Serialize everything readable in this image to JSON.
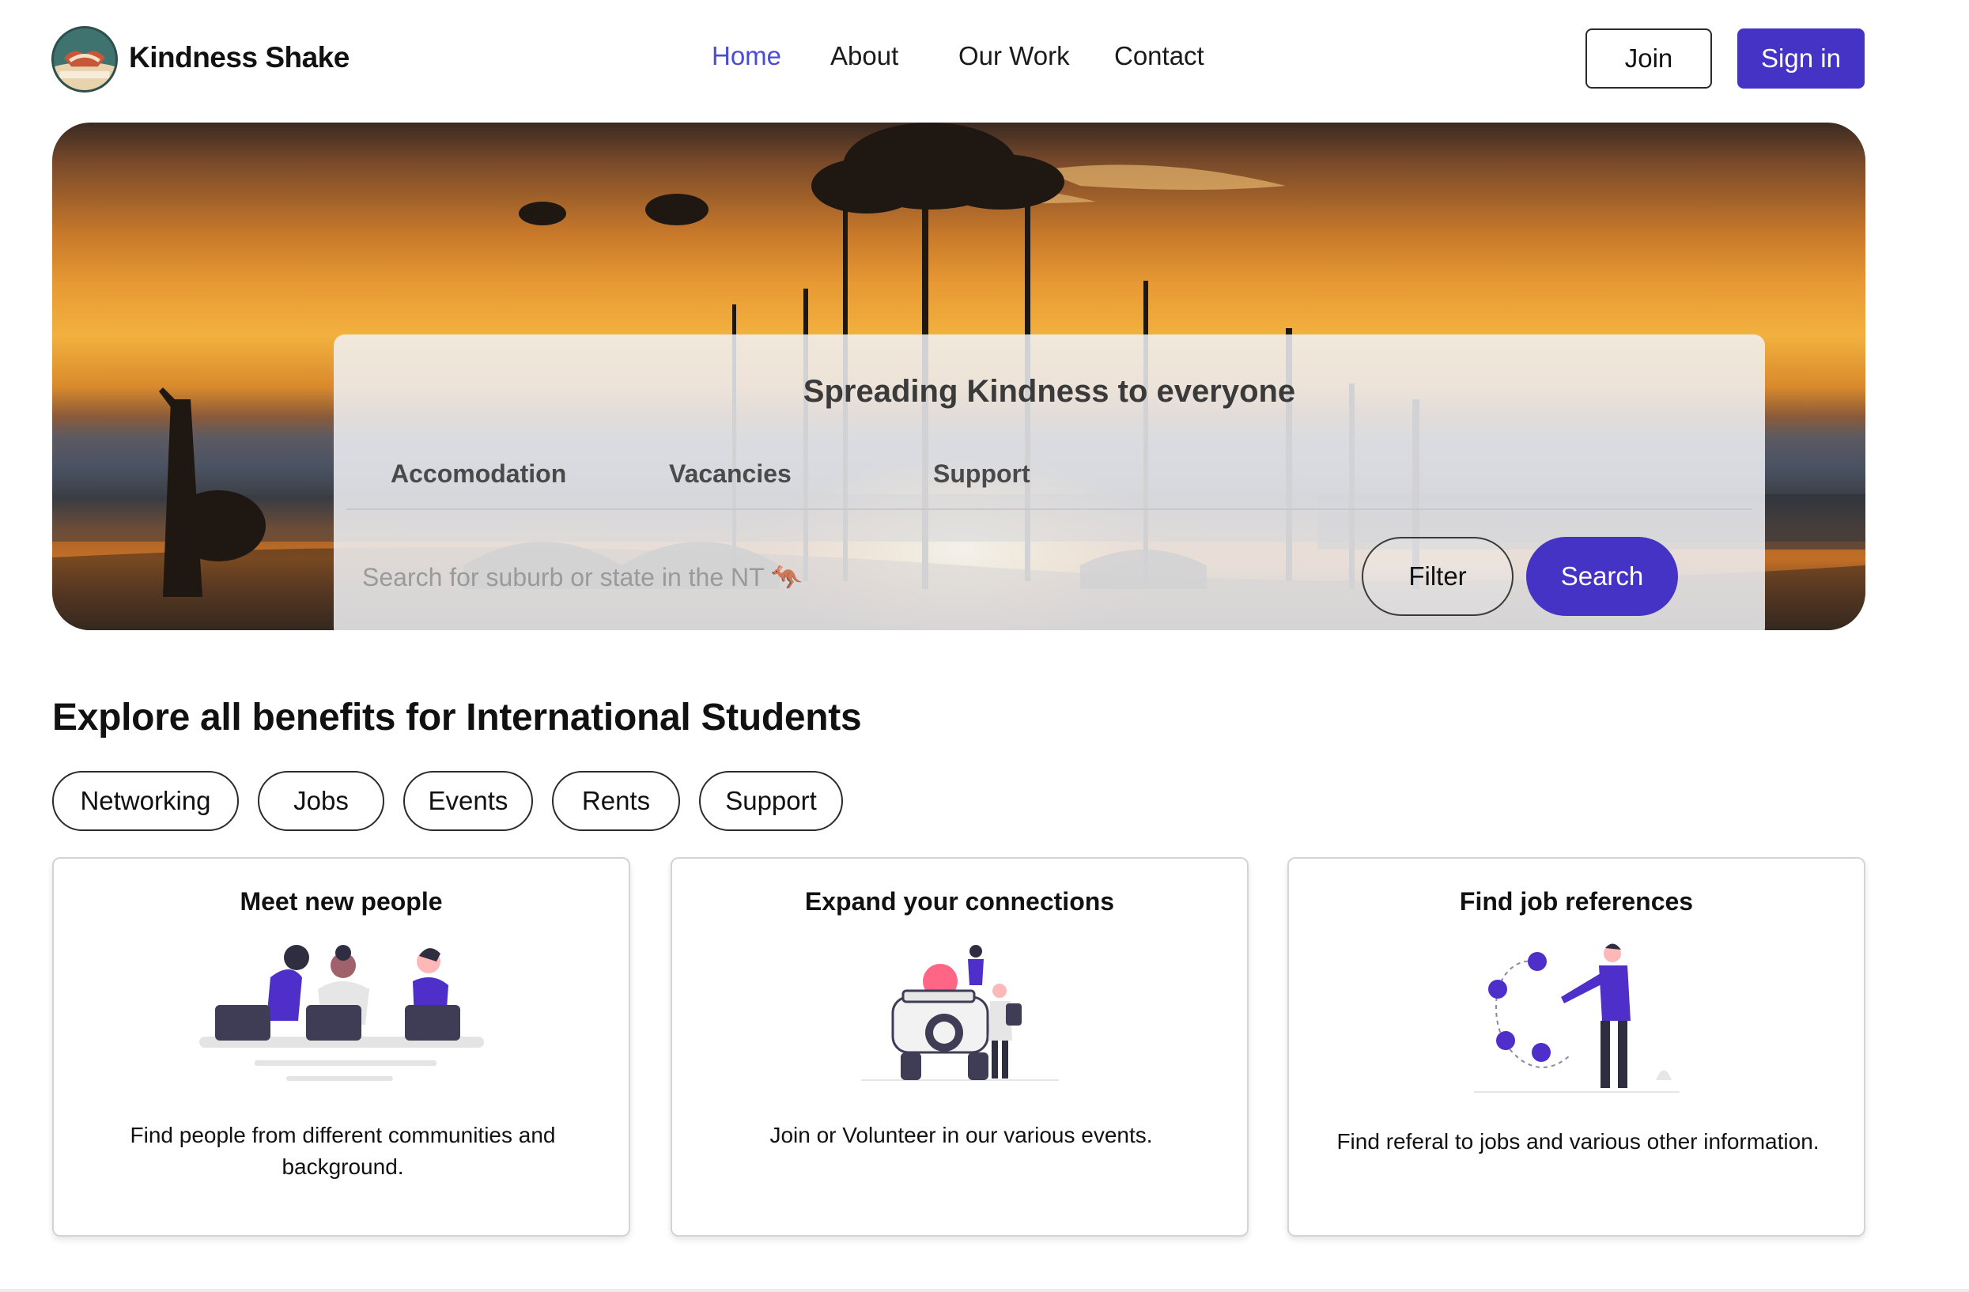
{
  "header": {
    "brand": "Kindness Shake",
    "logo_text": "#KINDNESSSHAKE",
    "nav": [
      {
        "label": "Home",
        "active": true
      },
      {
        "label": "About",
        "active": false
      },
      {
        "label": "Our Work",
        "active": false
      },
      {
        "label": "Contact",
        "active": false
      }
    ],
    "join_label": "Join",
    "signin_label": "Sign in"
  },
  "hero": {
    "title": "Spreading Kindness to everyone",
    "tabs": [
      "Accomodation",
      "Vacancies",
      "Support"
    ],
    "search_placeholder": "Search for suburb or state in the NT 🦘",
    "filter_label": "Filter",
    "search_label": "Search"
  },
  "explore": {
    "title": "Explore all benefits for International Students",
    "chips": [
      "Networking",
      "Jobs",
      "Events",
      "Rents",
      "Support"
    ],
    "cards": [
      {
        "title": "Meet new people",
        "description": "Find people from different communities and background.",
        "illustration": "people-working-laptops-illustration"
      },
      {
        "title": "Expand your connections",
        "description": "Join or Volunteer in our various events.",
        "illustration": "jeep-travellers-illustration"
      },
      {
        "title": "Find job references",
        "description": "Find referal to jobs and various other information.",
        "illustration": "social-network-person-illustration"
      }
    ]
  },
  "colors": {
    "accent": "#4433c4",
    "nav_active": "#4b4bd6",
    "illustration_purple": "#4f2fc9"
  }
}
